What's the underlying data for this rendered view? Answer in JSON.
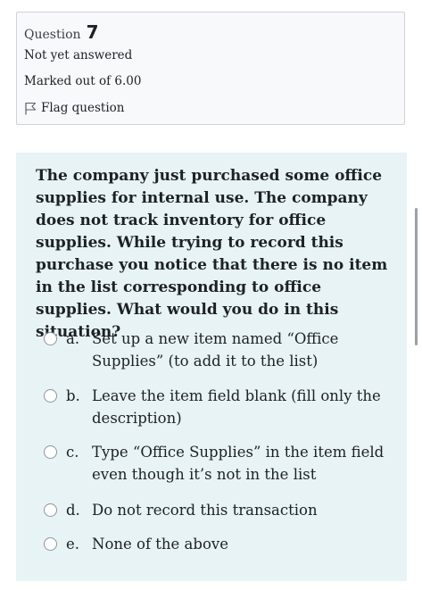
{
  "question_info": {
    "label": "Question",
    "number": "7",
    "status": "Not yet answered",
    "marks": "Marked out of 6.00",
    "flag_label": "Flag question",
    "flag_icon": "flag-icon"
  },
  "question": {
    "text": "The company just purchased some office supplies for internal use. The company does not track inventory for office supplies. While trying to record this purchase you notice that there is no item in the list corresponding to office supplies. What would you do in this situation?",
    "answers": [
      {
        "letter": "a.",
        "text": "Set up a new item named “Office Supplies” (to add it to the list)"
      },
      {
        "letter": "b.",
        "text": "Leave the item field blank (fill only the description)"
      },
      {
        "letter": "c.",
        "text": "Type “Office Supplies” in the item field even though it’s not in the list"
      },
      {
        "letter": "d.",
        "text": "Do not record this transaction"
      },
      {
        "letter": "e.",
        "text": "None of the above"
      }
    ]
  },
  "colors": {
    "info_background": "#f8f9fa",
    "content_background": "#e7f3f5",
    "text": "#1d2125",
    "border": "#cfd3d7"
  }
}
